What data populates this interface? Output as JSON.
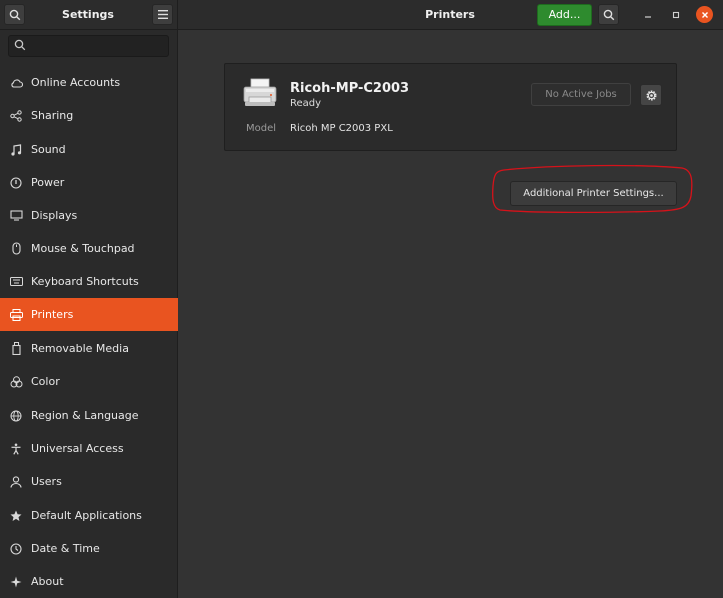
{
  "header": {
    "left_title": "Settings",
    "title": "Printers",
    "add_label": "Add...",
    "search_icon": "search-icon",
    "menu_icon": "hamburger-menu-icon"
  },
  "sidebar": {
    "search": {
      "placeholder": "",
      "value": ""
    },
    "items": [
      {
        "label": "Online Accounts",
        "icon": "cloud-icon"
      },
      {
        "label": "Sharing",
        "icon": "share-icon"
      },
      {
        "label": "Sound",
        "icon": "music-note-icon"
      },
      {
        "label": "Power",
        "icon": "power-icon"
      },
      {
        "label": "Displays",
        "icon": "display-icon"
      },
      {
        "label": "Mouse & Touchpad",
        "icon": "mouse-icon"
      },
      {
        "label": "Keyboard Shortcuts",
        "icon": "keyboard-icon"
      },
      {
        "label": "Printers",
        "icon": "printer-icon",
        "active": true
      },
      {
        "label": "Removable Media",
        "icon": "removable-media-icon"
      },
      {
        "label": "Color",
        "icon": "color-icon"
      },
      {
        "label": "Region & Language",
        "icon": "globe-icon"
      },
      {
        "label": "Universal Access",
        "icon": "accessibility-icon"
      },
      {
        "label": "Users",
        "icon": "user-icon"
      },
      {
        "label": "Default Applications",
        "icon": "star-icon"
      },
      {
        "label": "Date & Time",
        "icon": "clock-icon"
      },
      {
        "label": "About",
        "icon": "sparkle-icon"
      }
    ]
  },
  "printer": {
    "name": "Ricoh-MP-C2003",
    "status": "Ready",
    "model_label": "Model",
    "model_value": "Ricoh MP C2003 PXL",
    "jobs_label": "No Active Jobs"
  },
  "additional_settings_label": "Additional Printer Settings...",
  "colors": {
    "accent": "#e95420",
    "add_button": "#2e8b2e",
    "annotation": "#d6121a"
  }
}
